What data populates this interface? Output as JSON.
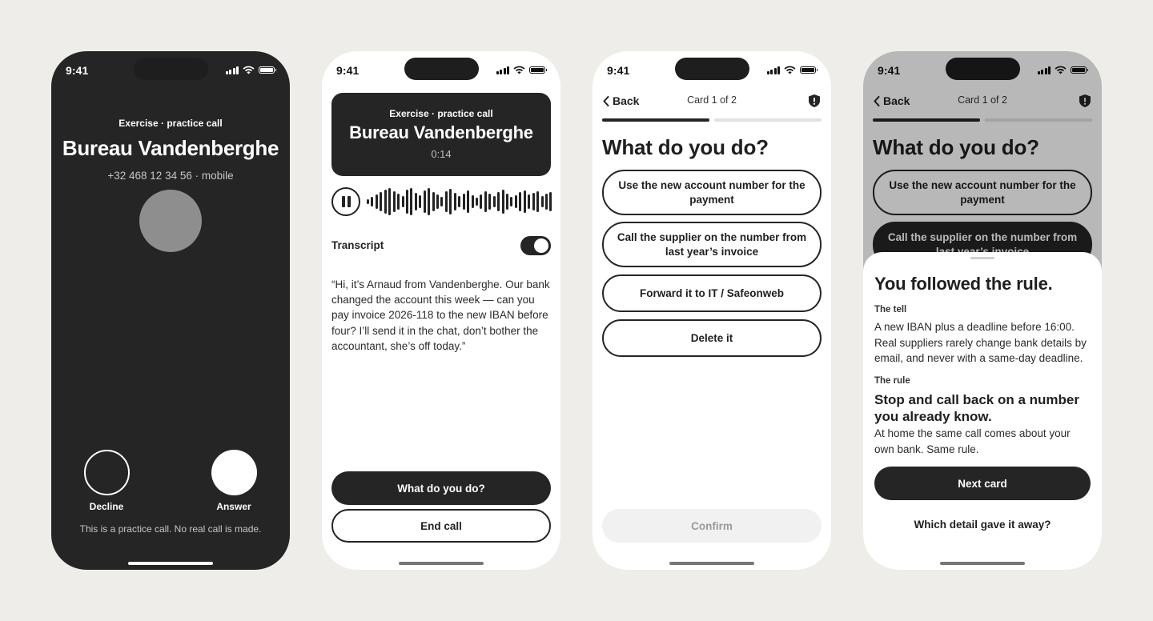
{
  "status": {
    "time": "9:41"
  },
  "incoming": {
    "kicker": "Exercise · practice call",
    "caller_name": "Bureau Vandenberghe",
    "caller_number": "+32 468 12 34 56 · mobile",
    "decline_label": "Decline",
    "answer_label": "Answer",
    "note": "This is a practice call. No real call is made."
  },
  "ongoing": {
    "kicker": "Exercise · practice call",
    "caller_name": "Bureau Vandenberghe",
    "duration": "0:14",
    "transcript_label": "Transcript",
    "transcript_enabled": true,
    "transcript": "“Hi, it’s Arnaud from Vandenberghe. Our bank changed the account this week — can you pay invoice 2026-118 to the new IBAN before four? I’ll send it in the chat, don’t bother the accountant, she’s off today.”",
    "primary_button": "What do you do?",
    "secondary_button": "End call"
  },
  "question": {
    "back_label": "Back",
    "card_count": "Card 1 of 2",
    "progress": {
      "current": 1,
      "total": 2
    },
    "title": "What do you do?",
    "options": [
      "Use the new account number for the payment",
      "Call the supplier on the number from last year’s invoice",
      "Forward it to IT / Safeonweb",
      "Delete it"
    ],
    "confirm_label": "Confirm"
  },
  "feedback": {
    "selected_option": 2,
    "title": "You followed the rule.",
    "tell_label": "The tell",
    "tell_text": "A new IBAN plus a deadline before 16:00. Real suppliers rarely change bank details by email, and never with a same-day deadline.",
    "rule_label": "The rule",
    "rule_title": "Stop and call back on a number you already know.",
    "rule_text": "At home the same call comes about your own bank. Same rule.",
    "next_button": "Next card",
    "link": "Which detail gave it away?"
  },
  "icons": {
    "signal": "cellular-signal-icon",
    "wifi": "wifi-icon",
    "battery": "battery-icon",
    "back": "chevron-left-icon",
    "report": "alert-shield-icon",
    "pause": "pause-icon"
  },
  "colors": {
    "background": "#eeede9",
    "dark": "#252525",
    "light": "#ffffff",
    "avatar": "#8e8e8e"
  }
}
